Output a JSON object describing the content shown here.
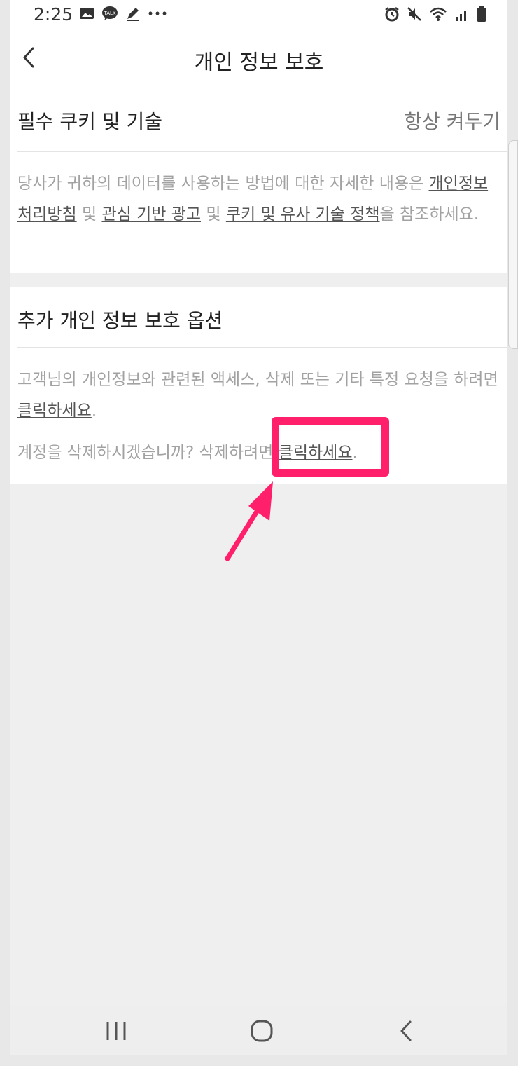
{
  "status_bar": {
    "time": "2:25",
    "left_icons": [
      "image-icon",
      "talk-icon",
      "pen-icon",
      "more-dots-icon"
    ],
    "right_icons": [
      "alarm-icon",
      "mute-icon",
      "wifi-icon",
      "signal-icon",
      "battery-icon"
    ]
  },
  "app_bar": {
    "title": "개인 정보 보호",
    "back_icon": "back-chevron-icon"
  },
  "section1": {
    "title": "필수 쿠키 및 기술",
    "status": "항상 켜두기",
    "text_1": "당사가 귀하의 데이터를 사용하는 방법에 대한 자세한 내용은 ",
    "link_privacy_policy": "개인정보처리방침",
    "text_2": " 및 ",
    "link_interest_ads": "관심 기반 광고",
    "text_3": " 및 ",
    "link_cookie_policy": "쿠키 및 유사 기술 정책",
    "text_4": "을 참조하세요."
  },
  "section2": {
    "title": "추가 개인 정보 보호 옵션",
    "request_text": "고객님의 개인정보와 관련된 액세스, 삭제 또는 기타 특정 요청을 하려면 ",
    "request_link": "클릭하세요",
    "period_1": ".",
    "delete_text": "계정을 삭제하시겠습니까? 삭제하려면 ",
    "delete_link": "클릭하세요",
    "period_2": "."
  },
  "annotation": {
    "highlight_color": "#ff1f6a"
  },
  "nav_bar": {
    "icons": [
      "recent-apps-icon",
      "home-icon",
      "back-icon"
    ]
  }
}
